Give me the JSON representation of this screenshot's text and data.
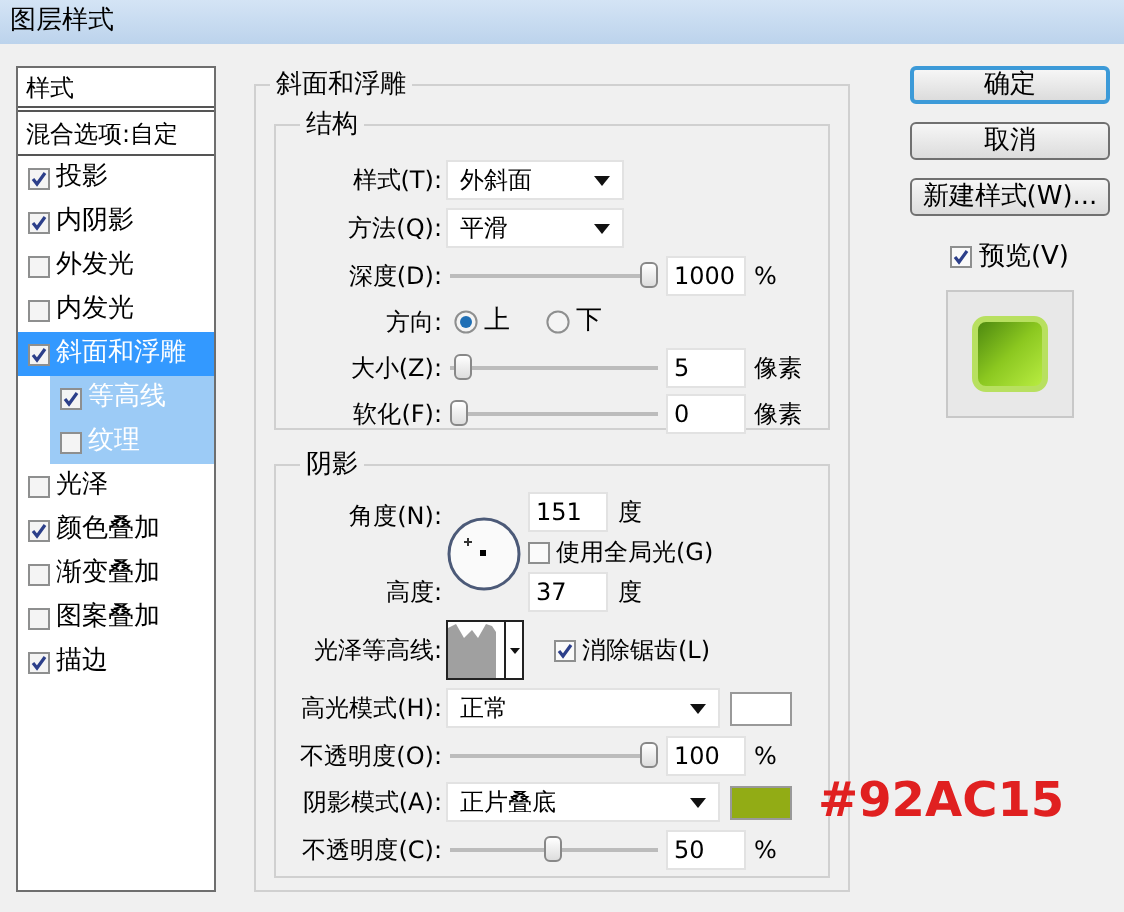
{
  "window": {
    "title": "图层样式"
  },
  "styles_panel": {
    "header": "样式",
    "blend_options": "混合选项:自定",
    "items": [
      {
        "label": "投影",
        "checked": true,
        "selected": false
      },
      {
        "label": "内阴影",
        "checked": true,
        "selected": false
      },
      {
        "label": "外发光",
        "checked": false,
        "selected": false
      },
      {
        "label": "内发光",
        "checked": false,
        "selected": false
      },
      {
        "label": "斜面和浮雕",
        "checked": true,
        "selected": true,
        "children": [
          {
            "label": "等高线",
            "checked": true,
            "selected": false
          },
          {
            "label": "纹理",
            "checked": false,
            "selected": false
          }
        ]
      },
      {
        "label": "光泽",
        "checked": false,
        "selected": false
      },
      {
        "label": "颜色叠加",
        "checked": true,
        "selected": false
      },
      {
        "label": "渐变叠加",
        "checked": false,
        "selected": false
      },
      {
        "label": "图案叠加",
        "checked": false,
        "selected": false
      },
      {
        "label": "描边",
        "checked": true,
        "selected": false
      }
    ]
  },
  "bevel": {
    "title": "斜面和浮雕",
    "structure": {
      "title": "结构",
      "style": {
        "label": "样式(T):",
        "value": "外斜面"
      },
      "technique": {
        "label": "方法(Q):",
        "value": "平滑"
      },
      "depth": {
        "label": "深度(D):",
        "level": 1,
        "value": "1000",
        "unit": "%"
      },
      "direction": {
        "label": "方向:",
        "options": [
          {
            "label": "上",
            "selected": true
          },
          {
            "label": "下",
            "selected": false
          }
        ]
      },
      "size": {
        "label": "大小(Z):",
        "level": 0.02,
        "value": "5",
        "unit": "像素"
      },
      "soften": {
        "label": "软化(F):",
        "level": 0,
        "value": "0",
        "unit": "像素"
      }
    },
    "shading": {
      "title": "阴影",
      "angle": {
        "label": "角度(N):",
        "value": "151",
        "unit": "度"
      },
      "global_light": {
        "label": "使用全局光(G)",
        "checked": false
      },
      "altitude": {
        "label": "高度:",
        "value": "37",
        "unit": "度"
      },
      "gloss_contour": {
        "label": "光泽等高线:"
      },
      "anti_aliased": {
        "label": "消除锯齿(L)",
        "checked": true
      },
      "highlight_mode": {
        "label": "高光模式(H):",
        "value": "正常",
        "color": "#ffffff"
      },
      "highlight_opacity": {
        "label": "不透明度(O):",
        "level": 1,
        "value": "100",
        "unit": "%"
      },
      "shadow_mode": {
        "label": "阴影模式(A):",
        "value": "正片叠底",
        "color": "#92ac15"
      },
      "shadow_opacity": {
        "label": "不透明度(C):",
        "level": 0.49,
        "value": "50",
        "unit": "%"
      }
    }
  },
  "buttons": [
    {
      "label": "确定",
      "default": true
    },
    {
      "label": "取消",
      "default": false
    },
    {
      "label": "新建样式(W)...",
      "default": false
    }
  ],
  "preview": {
    "label": "预览(V)",
    "checked": true
  },
  "annotation": "#92AC15"
}
